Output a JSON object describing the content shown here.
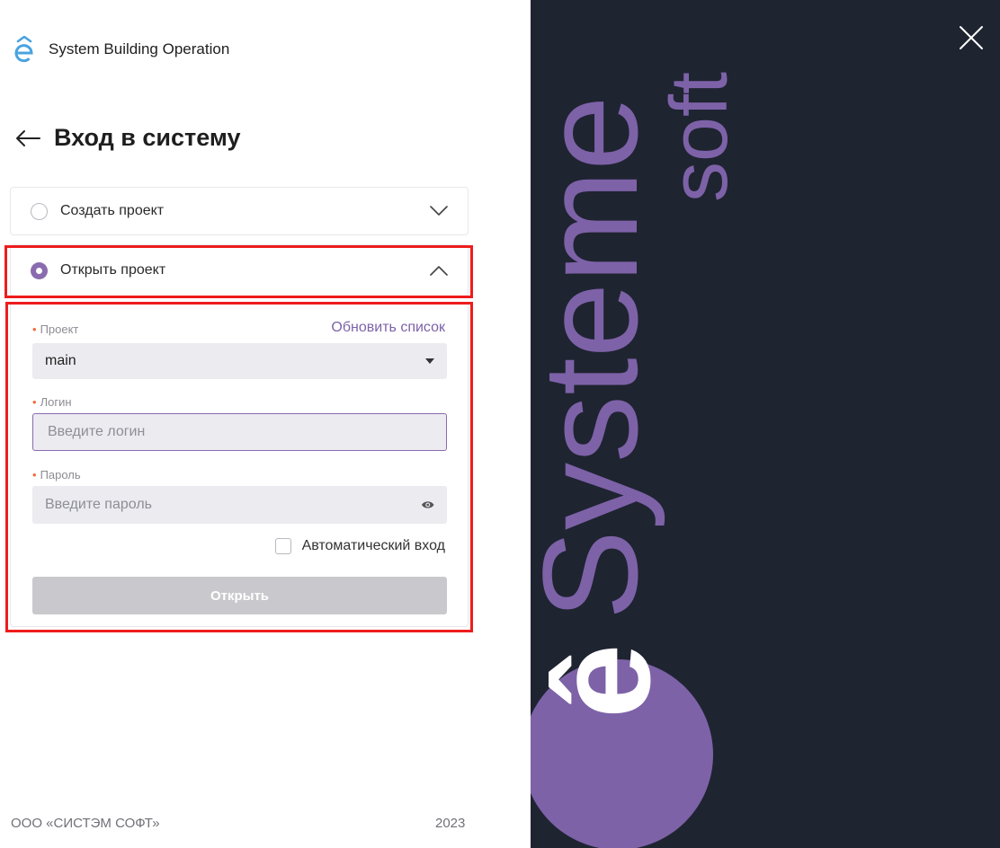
{
  "app": {
    "name": "System Building Operation",
    "logo_icon": "systeme-logo-icon"
  },
  "page": {
    "title": "Вход в систему"
  },
  "accordion": {
    "create": {
      "label": "Создать проект",
      "selected": false
    },
    "open": {
      "label": "Открыть проект",
      "selected": true
    }
  },
  "form": {
    "project": {
      "label": "Проект",
      "value": "main",
      "refresh_label": "Обновить список"
    },
    "login": {
      "label": "Логин",
      "placeholder": "Введите логин",
      "value": ""
    },
    "password": {
      "label": "Пароль",
      "placeholder": "Введите пароль",
      "value": ""
    },
    "auto_login": {
      "label": "Автоматический вход",
      "checked": false
    },
    "submit_label": "Открыть"
  },
  "footer": {
    "company": "ООО «СИСТЭМ СОФТ»",
    "year": "2023"
  },
  "brand": {
    "word": "Systeme",
    "word_accent": "ê",
    "sub": "soft"
  },
  "colors": {
    "accent": "#8a6bb0",
    "brand_bg": "#1f2431",
    "brand_purple": "#7d62a8",
    "required": "#f26b3a",
    "highlight": "#ee1c1c"
  }
}
